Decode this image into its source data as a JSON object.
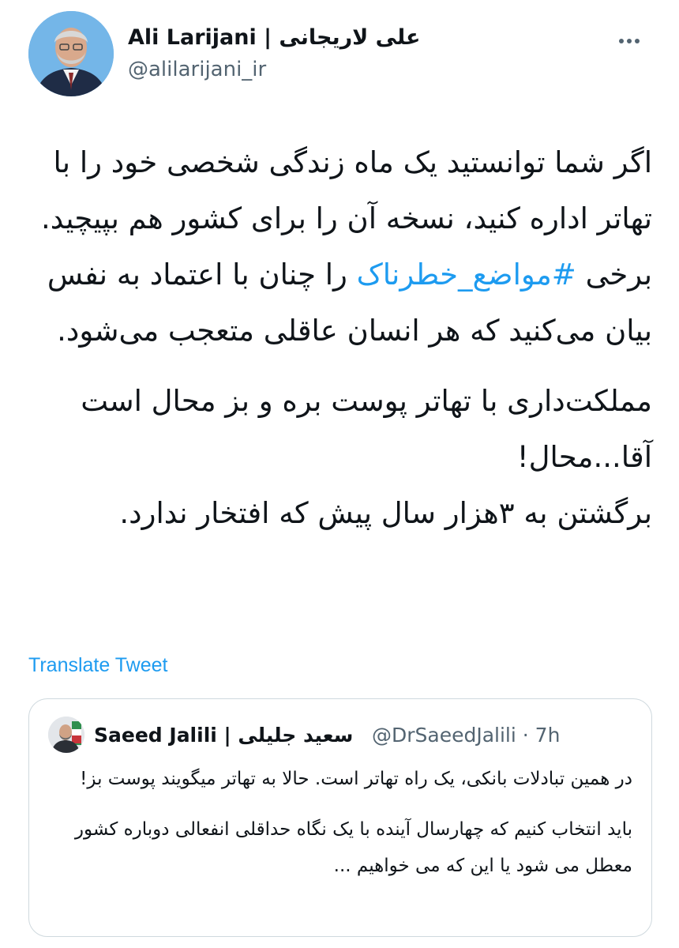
{
  "author": {
    "display_name": "Ali Larijani | علی لاریجانی",
    "handle": "@alilarijani_ir",
    "avatar_icon": "user-photo-avatar"
  },
  "more_icon": "ellipsis-icon",
  "tweet": {
    "para1": "اگر شما توانستید یک ماه زندگی شخصی خود را با تهاتر اداره کنید، نسخه آن را برای کشور هم بپیچید.",
    "para2_pre": "برخی ",
    "hashtag": "#مواضع_خطرناک",
    "para2_post": " را چنان با اعتماد به نفس بیان می‌کنید که هر انسان عاقلی متعجب می‌شود.",
    "para3": "مملکت‌داری با تهاتر پوست بره و بز محال است آقا...محال!",
    "para4": "برگشتن به ۳هزار سال پیش که افتخار ندارد."
  },
  "translate_label": "Translate Tweet",
  "quote": {
    "display_name": "Saeed Jalili | سعید جلیلی",
    "meta": "@DrSaeedJalili · 7h",
    "para1": "در همین تبادلات بانکی، یک راه تهاتر است. حالا به تهاتر میگویند پوست بز!",
    "para2": "باید انتخاب کنیم که چهارسال آینده با یک نگاه حداقلی انفعالی دوباره کشور معطل می شود یا این که می خواهیم ..."
  },
  "colors": {
    "link": "#1d9bf0",
    "secondary_text": "#536471",
    "border": "#cfd9de"
  }
}
